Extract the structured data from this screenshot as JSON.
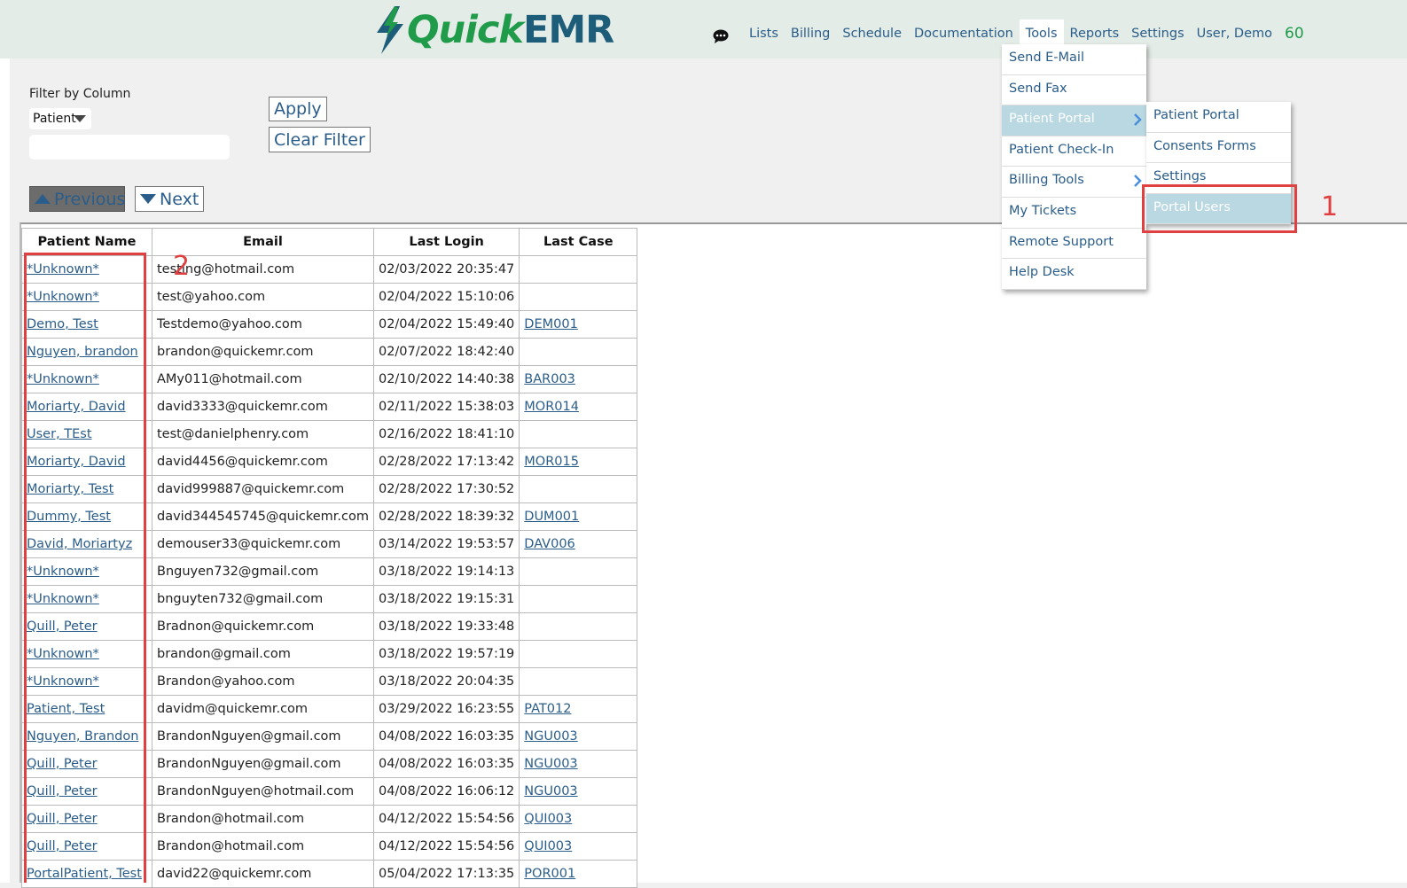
{
  "header": {
    "logo_quick": "Quick",
    "logo_emr": "EMR",
    "nav": [
      "Lists",
      "Billing",
      "Schedule",
      "Documentation",
      "Tools",
      "Reports",
      "Settings",
      "User, Demo"
    ],
    "count": "60"
  },
  "filter": {
    "label": "Filter by Column",
    "column_value": "Patient",
    "text_value": "",
    "apply_label": "Apply",
    "clear_label": "Clear Filter"
  },
  "pager": {
    "prev_label": "Previous",
    "next_label": "Next"
  },
  "tools_menu": {
    "items": [
      "Send E-Mail",
      "Send Fax",
      "Patient Portal",
      "Patient Check-In",
      "Billing Tools",
      "My Tickets",
      "Remote Support",
      "Help Desk"
    ],
    "highlighted": "Patient Portal"
  },
  "portal_submenu": {
    "items": [
      "Patient Portal",
      "Consents Forms",
      "Settings",
      "Portal Users"
    ],
    "highlighted": "Portal Users"
  },
  "table": {
    "headers": [
      "Patient Name",
      "Email",
      "Last Login",
      "Last Case"
    ],
    "rows": [
      [
        "*Unknown*",
        "testing@hotmail.com",
        "02/03/2022 20:35:47",
        ""
      ],
      [
        "*Unknown*",
        "test@yahoo.com",
        "02/04/2022 15:10:06",
        ""
      ],
      [
        "Demo, Test",
        "Testdemo@yahoo.com",
        "02/04/2022 15:49:40",
        "DEM001"
      ],
      [
        "Nguyen, brandon",
        "brandon@quickemr.com",
        "02/07/2022 18:42:40",
        ""
      ],
      [
        "*Unknown*",
        "AMy011@hotmail.com",
        "02/10/2022 14:40:38",
        "BAR003"
      ],
      [
        "Moriarty, David",
        "david3333@quickemr.com",
        "02/11/2022 15:38:03",
        "MOR014"
      ],
      [
        "User, TEst",
        "test@danielphenry.com",
        "02/16/2022 18:41:10",
        ""
      ],
      [
        "Moriarty, David",
        "david4456@quickemr.com",
        "02/28/2022 17:13:42",
        "MOR015"
      ],
      [
        "Moriarty, Test",
        "david999887@quickemr.com",
        "02/28/2022 17:30:52",
        ""
      ],
      [
        "Dummy, Test",
        "david344545745@quickemr.com",
        "02/28/2022 18:39:32",
        "DUM001"
      ],
      [
        "David, Moriartyz",
        "demouser33@quickemr.com",
        "03/14/2022 19:53:57",
        "DAV006"
      ],
      [
        "*Unknown*",
        "Bnguyen732@gmail.com",
        "03/18/2022 19:14:13",
        ""
      ],
      [
        "*Unknown*",
        "bnguyten732@gmail.com",
        "03/18/2022 19:15:31",
        ""
      ],
      [
        "Quill, Peter",
        "Bradnon@quickemr.com",
        "03/18/2022 19:33:48",
        ""
      ],
      [
        "*Unknown*",
        "brandon@gmail.com",
        "03/18/2022 19:57:19",
        ""
      ],
      [
        "*Unknown*",
        "Brandon@yahoo.com",
        "03/18/2022 20:04:35",
        ""
      ],
      [
        "Patient, Test",
        "davidm@quickemr.com",
        "03/29/2022 16:23:55",
        "PAT012"
      ],
      [
        "Nguyen, Brandon",
        "BrandonNguyen@gmail.com",
        "04/08/2022 16:03:35",
        "NGU003"
      ],
      [
        "Quill, Peter",
        "BrandonNguyen@gmail.com",
        "04/08/2022 16:03:35",
        "NGU003"
      ],
      [
        "Quill, Peter",
        "BrandonNguyen@hotmail.com",
        "04/08/2022 16:06:12",
        "NGU003"
      ],
      [
        "Quill, Peter",
        "Brandon@hotmail.com",
        "04/12/2022 15:54:56",
        "QUI003"
      ],
      [
        "Quill, Peter",
        "Brandon@hotmail.com",
        "04/12/2022 15:54:56",
        "QUI003"
      ],
      [
        "PortalPatient, Test",
        "david22@quickemr.com",
        "05/04/2022 17:13:35",
        "POR001"
      ]
    ]
  },
  "annotations": {
    "first": "1",
    "second": "2"
  },
  "colors": {
    "accent_green": "#1f9b4a",
    "link_blue": "#2a5d8a",
    "highlight": "#b9d8e2",
    "annotation_red": "#e04040"
  },
  "icons": {
    "logo": "lightning-bolt-icon",
    "chat": "chat-bubble-icon",
    "submenu": "chevron-right-icon",
    "prev": "triangle-up-icon",
    "next": "triangle-down-icon",
    "select": "triangle-down-icon"
  }
}
